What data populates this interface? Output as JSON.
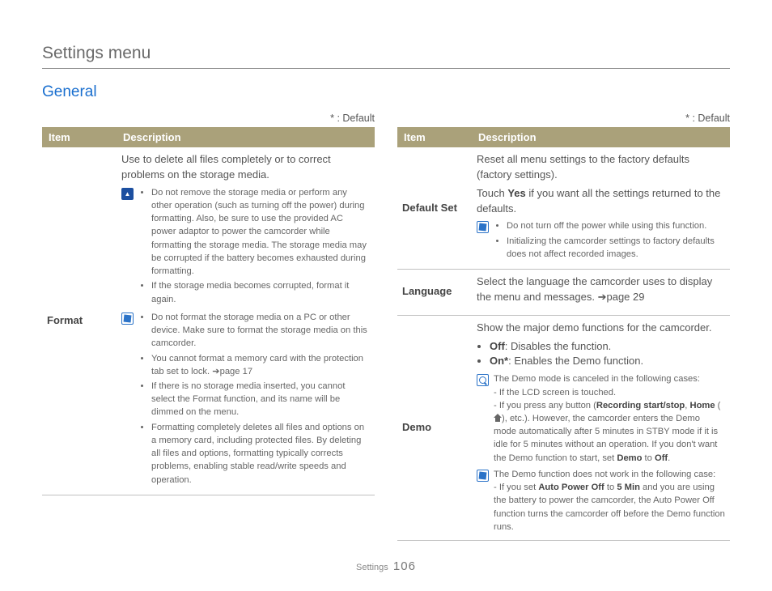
{
  "page_title": "Settings menu",
  "section_title": "General",
  "default_note": "* : Default",
  "headers": {
    "item": "Item",
    "description": "Description"
  },
  "footer": {
    "label": "Settings",
    "page": "106"
  },
  "left": {
    "format": {
      "item": "Format",
      "lead": "Use to delete all files completely or to correct problems on the storage media.",
      "warn": [
        "Do not remove the storage media or perform any other operation (such as turning off the power) during formatting. Also, be sure to use the provided AC power adaptor to power the camcorder while formatting the storage media. The storage media may be corrupted if the battery becomes exhausted during formatting.",
        "If the storage media becomes corrupted, format it again."
      ],
      "note": [
        "Do not format the storage media on a PC or other device. Make sure to format the storage media on this camcorder.",
        "You cannot format a memory card with the protection tab set to lock. ➔page 17",
        "If there is no storage media inserted, you cannot select the Format function, and its name will be dimmed on the menu.",
        "Formatting completely deletes all files and options on a memory card, including protected files. By deleting all files and options, formatting typically corrects problems, enabling stable read/write speeds and operation."
      ]
    }
  },
  "right": {
    "default_set": {
      "item": "Default Set",
      "lead1": "Reset all menu settings to the factory defaults (factory settings).",
      "lead2a": "Touch ",
      "lead2b": "Yes",
      "lead2c": " if you want all the settings returned to the defaults.",
      "note": [
        "Do not turn off the power while using this function.",
        "Initializing the camcorder settings to factory defaults does not affect recorded images."
      ]
    },
    "language": {
      "item": "Language",
      "lead": "Select the language the camcorder uses to display the menu and messages. ➔page 29"
    },
    "demo": {
      "item": "Demo",
      "lead": "Show the major demo functions for the camcorder.",
      "off_label": "Off",
      "off_text": ": Disables the function.",
      "on_label": "On*",
      "on_text": ": Enables the Demo function.",
      "mag_intro": "The Demo mode is canceled in the following cases:",
      "mag_l1": "- If the LCD screen is touched.",
      "mag_l2a": "- If you press any button (",
      "mag_l2b": "Recording start/stop",
      "mag_l2c": ", ",
      "mag_l2d": "Home",
      "mag_l2e": " (",
      "mag_l2f": "), etc.). However, the camcorder enters the Demo mode automatically after 5 minutes in STBY mode if it is idle for 5 minutes without an operation. If you don't want the Demo function to start, set ",
      "mag_l2g": "Demo",
      "mag_l2h": " to ",
      "mag_l2i": "Off",
      "mag_l2j": ".",
      "note2_intro": "The Demo function does not work in the following case:",
      "note2_a": "- If you set ",
      "note2_b": "Auto Power Off",
      "note2_c": " to ",
      "note2_d": "5 Min",
      "note2_e": " and you are using the battery to power the camcorder, the Auto Power Off function turns the camcorder off before the Demo function runs."
    }
  }
}
